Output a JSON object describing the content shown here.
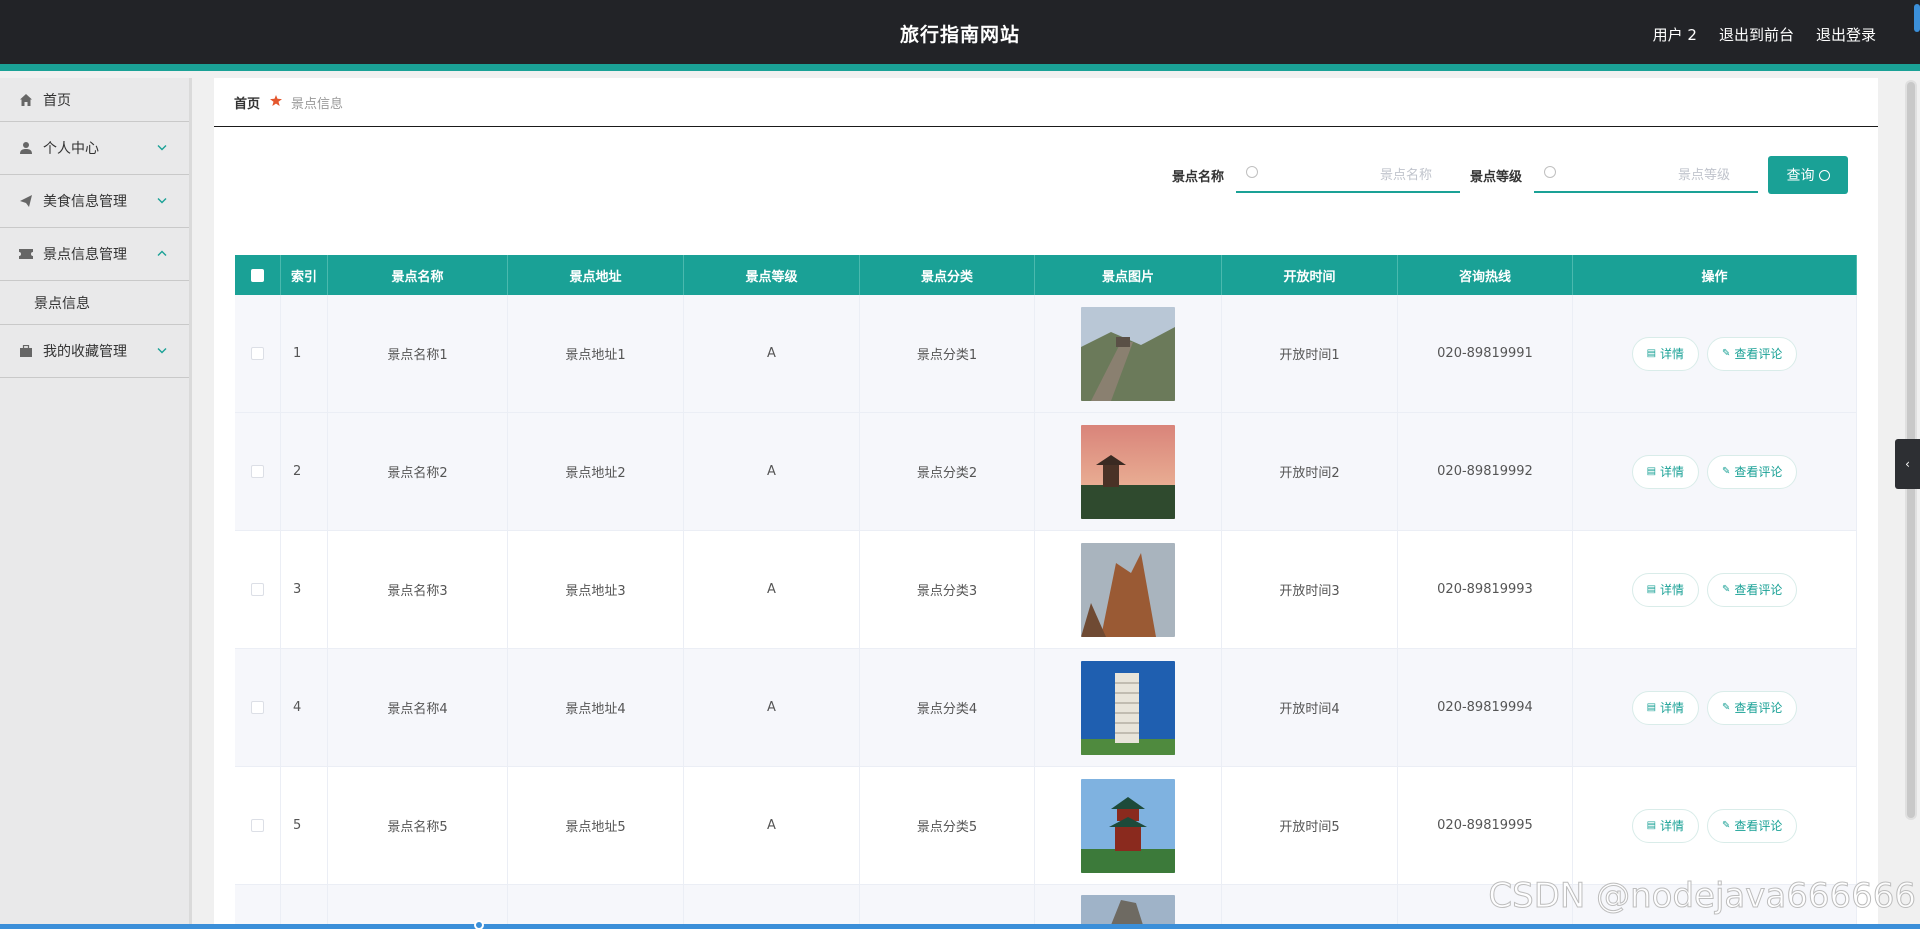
{
  "header": {
    "title": "旅行指南网站",
    "user": "用户 2",
    "exit_front": "退出到前台",
    "logout": "退出登录"
  },
  "sidebar": {
    "items": [
      {
        "label": "首页",
        "icon": "home-icon"
      },
      {
        "label": "个人中心",
        "icon": "user-icon"
      },
      {
        "label": "美食信息管理",
        "icon": "paper-plane-icon"
      },
      {
        "label": "景点信息管理",
        "icon": "ticket-icon"
      },
      {
        "label": "景点信息"
      },
      {
        "label": "我的收藏管理",
        "icon": "briefcase-icon"
      }
    ]
  },
  "breadcrumb": {
    "home": "首页",
    "current": "景点信息"
  },
  "search": {
    "name_label": "景点名称",
    "name_placeholder": "景点名称",
    "level_label": "景点等级",
    "level_placeholder": "景点等级",
    "button": "查询"
  },
  "table": {
    "headers": [
      "索引",
      "景点名称",
      "景点地址",
      "景点等级",
      "景点分类",
      "景点图片",
      "开放时间",
      "咨询热线",
      "操作"
    ],
    "rows": [
      {
        "idx": "1",
        "name": "景点名称1",
        "addr": "景点地址1",
        "level": "A",
        "cat": "景点分类1",
        "time": "开放时间1",
        "phone": "020-89819991"
      },
      {
        "idx": "2",
        "name": "景点名称2",
        "addr": "景点地址2",
        "level": "A",
        "cat": "景点分类2",
        "time": "开放时间2",
        "phone": "020-89819992"
      },
      {
        "idx": "3",
        "name": "景点名称3",
        "addr": "景点地址3",
        "level": "A",
        "cat": "景点分类3",
        "time": "开放时间3",
        "phone": "020-89819993"
      },
      {
        "idx": "4",
        "name": "景点名称4",
        "addr": "景点地址4",
        "level": "A",
        "cat": "景点分类4",
        "time": "开放时间4",
        "phone": "020-89819994"
      },
      {
        "idx": "5",
        "name": "景点名称5",
        "addr": "景点地址5",
        "level": "A",
        "cat": "景点分类5",
        "time": "开放时间5",
        "phone": "020-89819995"
      }
    ],
    "detail_btn": "详情",
    "comment_btn": "查看评论"
  },
  "watermark": "CSDN @nodejava666666",
  "colors": {
    "accent": "#1aa196",
    "topbar": "#222327",
    "sidebar": "#e9e9ea"
  }
}
